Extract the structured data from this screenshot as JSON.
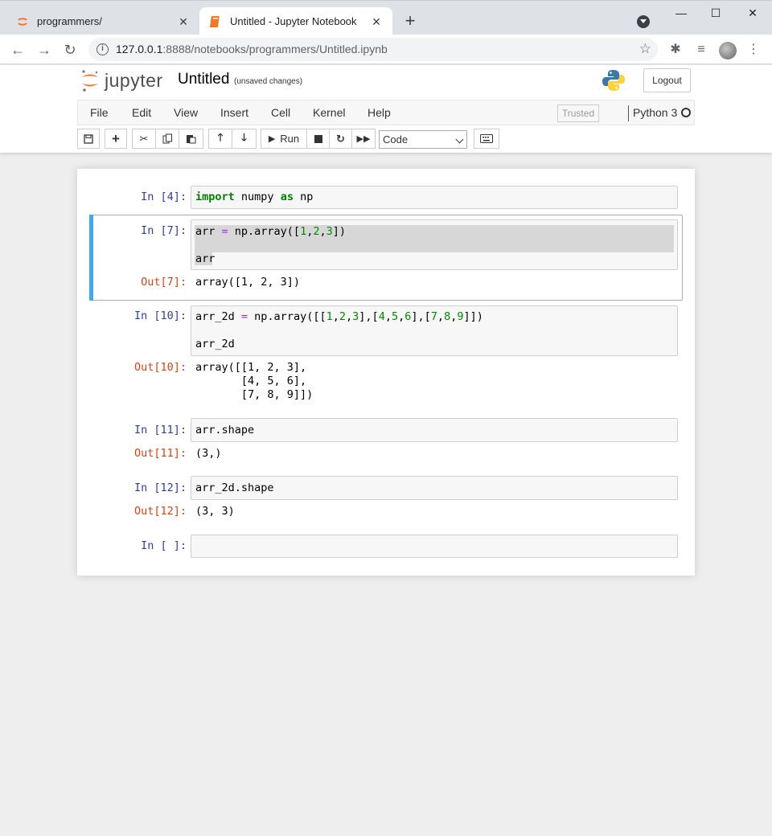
{
  "browser": {
    "tabs": [
      {
        "title": "programmers/",
        "active": false
      },
      {
        "title": "Untitled - Jupyter Notebook",
        "active": true
      }
    ],
    "url_host": "127.0.0.1",
    "url_rest": ":8888/notebooks/programmers/Untitled.ipynb"
  },
  "jupyter": {
    "logo_text": "jupyter",
    "notebook_title": "Untitled",
    "autosave_status": "(unsaved changes)",
    "logout_label": "Logout",
    "menu": [
      "File",
      "Edit",
      "View",
      "Insert",
      "Cell",
      "Kernel",
      "Help"
    ],
    "trusted_label": "Trusted",
    "kernel_name": "Python 3",
    "run_label": "Run",
    "cell_type": "Code"
  },
  "cells": [
    {
      "in_prompt": "In [4]:",
      "code": [
        "import numpy as np"
      ]
    },
    {
      "in_prompt": "In [7]:",
      "code": [
        "arr = np.array([1,2,3])",
        "",
        "arr"
      ],
      "out_prompt": "Out[7]:",
      "output": "array([1, 2, 3])"
    },
    {
      "in_prompt": "In [10]:",
      "code": [
        "arr_2d = np.array([[1,2,3],[4,5,6],[7,8,9]])",
        "",
        "arr_2d"
      ],
      "out_prompt": "Out[10]:",
      "output": "array([[1, 2, 3],\n       [4, 5, 6],\n       [7, 8, 9]])"
    },
    {
      "in_prompt": "In [11]:",
      "code": [
        "arr.shape"
      ],
      "out_prompt": "Out[11]:",
      "output": "(3,)"
    },
    {
      "in_prompt": "In [12]:",
      "code": [
        "arr_2d.shape"
      ],
      "out_prompt": "Out[12]:",
      "output": "(3, 3)"
    },
    {
      "in_prompt": "In [ ]:",
      "code": [
        ""
      ]
    }
  ],
  "colors": {
    "accent": "#42a5f5",
    "in_prompt": "#303f9f",
    "out_prompt": "#d84315",
    "jupyter_orange": "#f37726"
  }
}
